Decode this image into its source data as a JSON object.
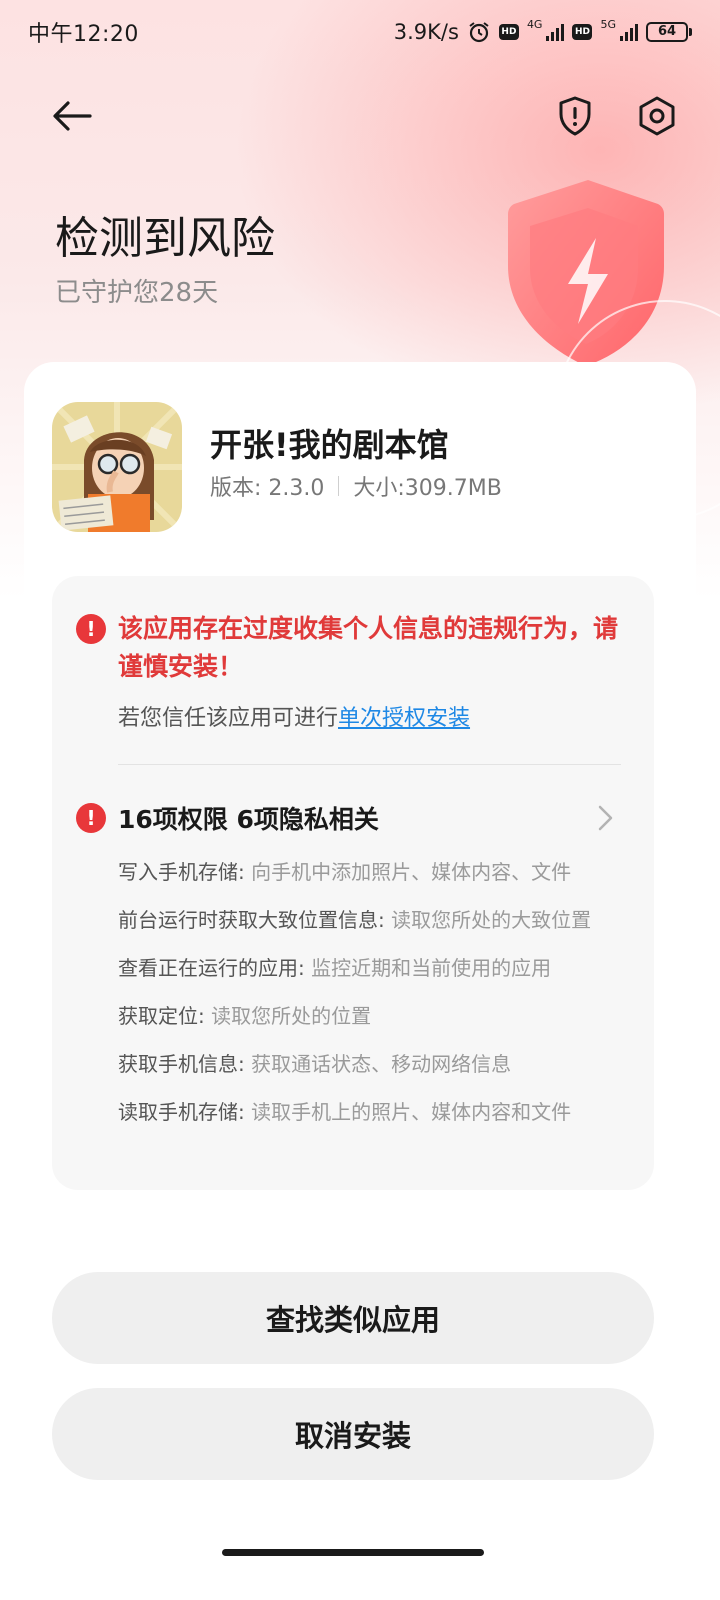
{
  "status_bar": {
    "time": "中午12:20",
    "net_speed": "3.9K/s",
    "hd_label": "HD",
    "sim1_network": "4G",
    "sim2_network": "5G",
    "battery": "64"
  },
  "header": {
    "title": "检测到风险",
    "subtitle": "已守护您28天"
  },
  "app": {
    "name": "开张!我的剧本馆",
    "version": "版本: 2.3.0",
    "size": "大小:309.7MB"
  },
  "risk": {
    "warning_text": "该应用存在过度收集个人信息的违规行为，请谨慎安装！",
    "trust_prefix": "若您信任该应用可进行",
    "trust_link": "单次授权安装",
    "permissions_summary": "16项权限 6项隐私相关",
    "permissions": [
      {
        "name": "写入手机存储:",
        "desc": " 向手机中添加照片、媒体内容、文件"
      },
      {
        "name": "前台运行时获取大致位置信息:",
        "desc": " 读取您所处的大致位置"
      },
      {
        "name": "查看正在运行的应用:",
        "desc": " 监控近期和当前使用的应用"
      },
      {
        "name": "获取定位:",
        "desc": " 读取您所处的位置"
      },
      {
        "name": "获取手机信息:",
        "desc": " 获取通话状态、移动网络信息"
      },
      {
        "name": "读取手机存储:",
        "desc": " 读取手机上的照片、媒体内容和文件"
      }
    ]
  },
  "buttons": {
    "find_similar": "查找类似应用",
    "cancel_install": "取消安装"
  },
  "colors": {
    "danger": "#e03a3a",
    "link": "#1e88e5",
    "button_bg": "#efefef"
  }
}
